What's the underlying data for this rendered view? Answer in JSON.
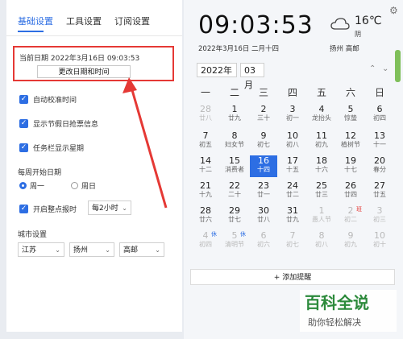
{
  "tabs": [
    "基础设置",
    "工具设置",
    "订阅设置"
  ],
  "current_date_label": "当前日期",
  "current_date_value": "2022年3月16日  09:03:53",
  "change_button": "更改日期和时间",
  "auto_time": "自动校准时间",
  "show_holiday": "显示节假日抢票信息",
  "taskbar_week": "任务栏显示星期",
  "week_start_label": "每周开始日期",
  "week_start_options": [
    "周一",
    "周日"
  ],
  "hourly_chime": "开启整点报时",
  "hourly_select": "每2小时",
  "city_label": "城市设置",
  "city": {
    "province": "江苏",
    "city": "扬州",
    "district": "高邮"
  },
  "clock": {
    "time": "09:03:53",
    "date": "2022年3月16日  二月十四"
  },
  "weather": {
    "temp": "16℃",
    "desc": "阴",
    "location": "扬州 高邮"
  },
  "calendar": {
    "year": "2022年",
    "month": "03月",
    "weekdays": [
      "一",
      "二",
      "三",
      "四",
      "五",
      "六",
      "日"
    ],
    "weeks": [
      [
        [
          "28",
          "廿八",
          "other",
          ""
        ],
        [
          "1",
          "廿九",
          "",
          ""
        ],
        [
          "2",
          "三十",
          "",
          ""
        ],
        [
          "3",
          "初一",
          "",
          ""
        ],
        [
          "4",
          "龙抬头",
          "",
          ""
        ],
        [
          "5",
          "惊蛰",
          "",
          ""
        ],
        [
          "6",
          "初四",
          "",
          ""
        ]
      ],
      [
        [
          "7",
          "初五",
          "",
          ""
        ],
        [
          "8",
          "妇女节",
          "",
          ""
        ],
        [
          "9",
          "初七",
          "",
          ""
        ],
        [
          "10",
          "初八",
          "",
          ""
        ],
        [
          "11",
          "初九",
          "",
          ""
        ],
        [
          "12",
          "植树节",
          "",
          ""
        ],
        [
          "13",
          "十一",
          "",
          ""
        ]
      ],
      [
        [
          "14",
          "十二",
          "",
          ""
        ],
        [
          "15",
          "消费者",
          "",
          ""
        ],
        [
          "16",
          "十四",
          "selected",
          ""
        ],
        [
          "17",
          "十五",
          "",
          ""
        ],
        [
          "18",
          "十六",
          "",
          ""
        ],
        [
          "19",
          "十七",
          "",
          ""
        ],
        [
          "20",
          "春分",
          "",
          ""
        ]
      ],
      [
        [
          "21",
          "十九",
          "",
          ""
        ],
        [
          "22",
          "二十",
          "",
          ""
        ],
        [
          "23",
          "廿一",
          "",
          ""
        ],
        [
          "24",
          "廿二",
          "",
          ""
        ],
        [
          "25",
          "廿三",
          "",
          ""
        ],
        [
          "26",
          "廿四",
          "",
          ""
        ],
        [
          "27",
          "廿五",
          "",
          ""
        ]
      ],
      [
        [
          "28",
          "廿六",
          "",
          ""
        ],
        [
          "29",
          "廿七",
          "",
          ""
        ],
        [
          "30",
          "廿八",
          "",
          ""
        ],
        [
          "31",
          "廿九",
          "",
          ""
        ],
        [
          "1",
          "愚人节",
          "other",
          ""
        ],
        [
          "2",
          "初二",
          "other",
          "班"
        ],
        [
          "3",
          "初三",
          "other",
          ""
        ]
      ],
      [
        [
          "4",
          "初四",
          "other",
          "休"
        ],
        [
          "5",
          "清明节",
          "other",
          "休"
        ],
        [
          "6",
          "初六",
          "other",
          ""
        ],
        [
          "7",
          "初七",
          "other",
          ""
        ],
        [
          "8",
          "初八",
          "other",
          ""
        ],
        [
          "9",
          "初九",
          "other",
          ""
        ],
        [
          "10",
          "初十",
          "other",
          ""
        ]
      ]
    ]
  },
  "add_reminder": "+ 添加提醒",
  "watermark": {
    "title": "百科全说",
    "sub": "助你轻松解决"
  },
  "colors": {
    "accent": "#2d6ee3",
    "highlight": "#e53935",
    "brand": "#2c8a3b"
  }
}
